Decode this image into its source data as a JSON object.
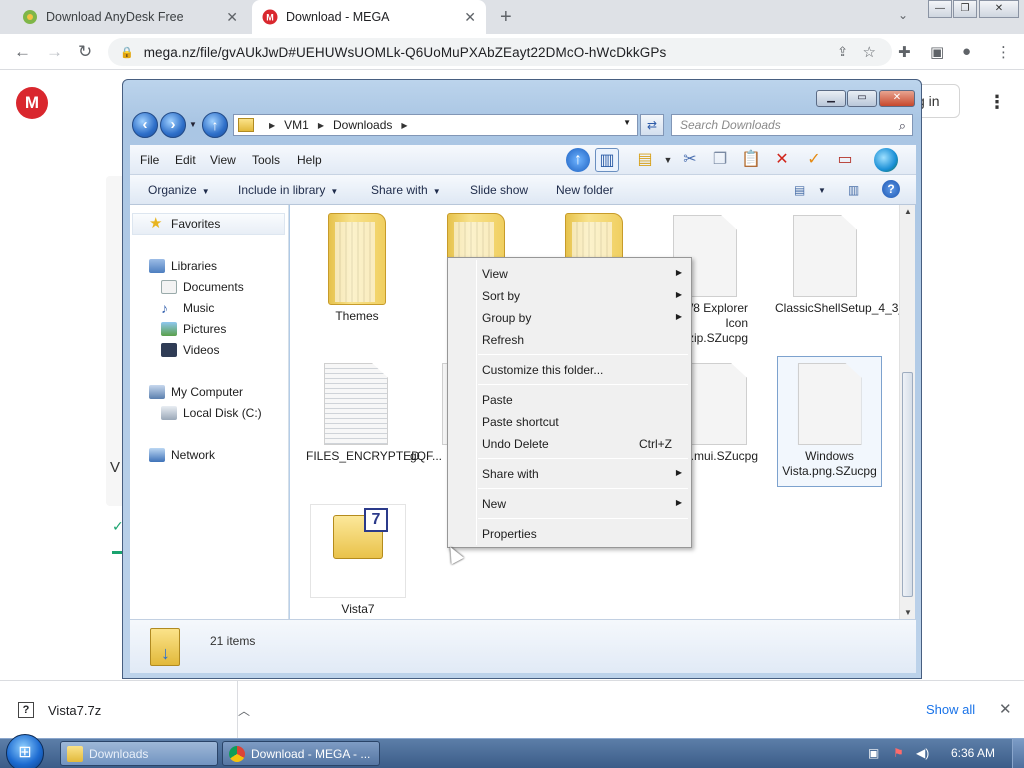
{
  "browser": {
    "tabs": [
      {
        "title": "Download AnyDesk Free",
        "active": false
      },
      {
        "title": "Download - MEGA",
        "active": true
      }
    ],
    "new_tab_label": "+",
    "url": "mega.nz/file/gvAUkJwD#UEHUWsUOMLk-Q6UoMuPXAbZEayt22DMcO-hWcDkkGPs"
  },
  "mega": {
    "logo": "M",
    "signin_text": "g in",
    "partial_heading": "V"
  },
  "explorer": {
    "breadcrumb": [
      "VM1",
      "Downloads"
    ],
    "search_placeholder": "Search Downloads",
    "menu": [
      "File",
      "Edit",
      "View",
      "Tools",
      "Help"
    ],
    "commands": [
      {
        "label": "Organize",
        "dropdown": true
      },
      {
        "label": "Include in library",
        "dropdown": true
      },
      {
        "label": "Share with",
        "dropdown": true
      },
      {
        "label": "Slide show",
        "dropdown": false
      },
      {
        "label": "New folder",
        "dropdown": false
      }
    ],
    "nav": {
      "favorites": "Favorites",
      "libraries": "Libraries",
      "library_items": [
        "Documents",
        "Music",
        "Pictures",
        "Videos"
      ],
      "computer": "My Computer",
      "drive": "Local Disk (C:)",
      "network": "Network"
    },
    "files": [
      {
        "name": "Themes",
        "type": "folder"
      },
      {
        "name": "",
        "type": "folder"
      },
      {
        "name": "",
        "type": "folder"
      },
      {
        "name": "W8 Explorer Icon ...7.zip.SZucpg",
        "type": "doc"
      },
      {
        "name": "ClassicShellSetup_4_3_1.exe.SZucpg",
        "type": "doc"
      },
      {
        "name": "FILES_ENCRYPTED",
        "type": "lined"
      },
      {
        "name": "gQF...",
        "type": "doc"
      },
      {
        "name": "...2.dll.mui.SZucpg",
        "type": "doc"
      },
      {
        "name": "Windows Vista.png.SZucpg",
        "type": "doc"
      },
      {
        "name": "Vista7",
        "type": "zip"
      }
    ],
    "item_count": "21 items"
  },
  "context_menu": {
    "items": [
      {
        "label": "View",
        "submenu": true
      },
      {
        "label": "Sort by",
        "submenu": true
      },
      {
        "label": "Group by",
        "submenu": true
      },
      {
        "label": "Refresh"
      },
      {
        "label": "Customize this folder..."
      },
      {
        "label": "Paste"
      },
      {
        "label": "Paste shortcut"
      },
      {
        "label": "Undo Delete",
        "shortcut": "Ctrl+Z"
      },
      {
        "label": "Share with",
        "submenu": true
      },
      {
        "label": "New",
        "submenu": true
      },
      {
        "label": "Properties"
      }
    ]
  },
  "download_bar": {
    "file": "Vista7.7z",
    "show_all": "Show all"
  },
  "taskbar": {
    "buttons": [
      "Downloads",
      "Download - MEGA - ..."
    ],
    "clock": "6:36 AM"
  },
  "colors": {
    "mega_red": "#d9272e",
    "link_blue": "#1a73e8",
    "win7_glass": "#aac6e4"
  }
}
